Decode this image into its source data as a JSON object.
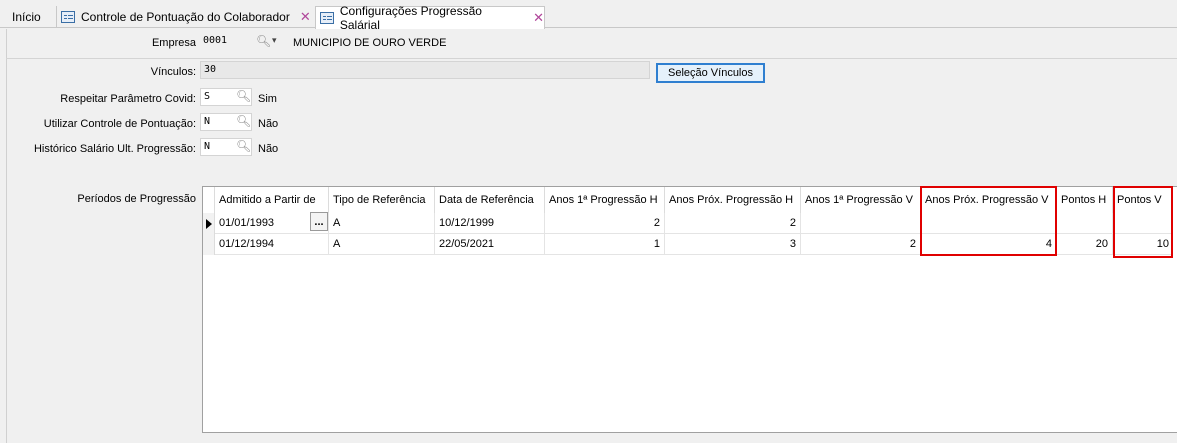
{
  "tabs": [
    {
      "label": "Início"
    },
    {
      "label": "Controle de Pontuação do Colaborador"
    },
    {
      "label": "Configurações Progressão Salárial"
    }
  ],
  "form": {
    "empresa_label": "Empresa",
    "empresa_code": "0001",
    "empresa_name": "MUNICIPIO DE OURO VERDE",
    "vinculos_label": "Vínculos:",
    "vinculos_value": "30",
    "selecao_button": "Seleção Vínculos",
    "covid_label": "Respeitar Parâmetro Covid:",
    "covid_code": "S",
    "covid_text": "Sim",
    "pontuacao_label": "Utilizar Controle de Pontuação:",
    "pontuacao_code": "N",
    "pontuacao_text": "Não",
    "historico_label": "Histórico Salário Ult. Progressão:",
    "historico_code": "N",
    "historico_text": "Não",
    "periodos_label": "Períodos de Progressão"
  },
  "grid": {
    "columns": [
      "Admitido a Partir de",
      "Tipo de Referência",
      "Data de Referência",
      "Anos 1ª Progressão H",
      "Anos Próx. Progressão H",
      "Anos 1ª Progressão V",
      "Anos Próx. Progressão V",
      "Pontos H",
      "Pontos V"
    ],
    "rows": [
      [
        "01/01/1993",
        "A",
        "10/12/1999",
        "2",
        "2",
        "",
        "",
        "",
        ""
      ],
      [
        "01/12/1994",
        "A",
        "22/05/2021",
        "1",
        "3",
        "2",
        "4",
        "20",
        "10"
      ]
    ],
    "ellipsis": "..."
  },
  "colors": {
    "highlight": "#e00000",
    "button_border": "#2f7fd0",
    "close_icon": "#b0469a"
  }
}
